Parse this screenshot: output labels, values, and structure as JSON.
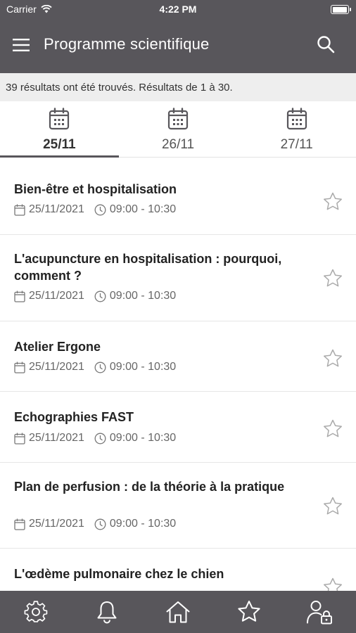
{
  "status_bar": {
    "carrier": "Carrier",
    "time": "4:22 PM"
  },
  "header": {
    "title": "Programme scientifique",
    "menu_icon": "hamburger-menu-icon",
    "search_icon": "search-icon"
  },
  "results": {
    "text": "39 résultats ont été trouvés. Résultats de 1 à 30."
  },
  "tabs": [
    {
      "label": "25/11",
      "active": true
    },
    {
      "label": "26/11",
      "active": false
    },
    {
      "label": "27/11",
      "active": false
    }
  ],
  "sessions": [
    {
      "title": "Bien-être et hospitalisation",
      "date": "25/11/2021",
      "time": "09:00 - 10:30"
    },
    {
      "title": "L'acupuncture en hospitalisation : pourquoi, comment ?",
      "date": "25/11/2021",
      "time": "09:00 - 10:30"
    },
    {
      "title": "Atelier Ergone",
      "date": "25/11/2021",
      "time": "09:00 - 10:30"
    },
    {
      "title": "Echographies FAST",
      "date": "25/11/2021",
      "time": "09:00 - 10:30"
    },
    {
      "title": "Plan de perfusion : de la théorie à la pratique",
      "date": "25/11/2021",
      "time": "09:00 - 10:30"
    },
    {
      "title": "L'œdème pulmonaire chez le chien",
      "date": "",
      "time": ""
    }
  ],
  "bottom_nav": [
    "settings-gear-icon",
    "notifications-bell-icon",
    "home-icon",
    "favorites-star-icon",
    "user-lock-icon"
  ],
  "colors": {
    "bar": "#58565b",
    "background": "#ffffff",
    "results_bg": "#eeeeee"
  }
}
